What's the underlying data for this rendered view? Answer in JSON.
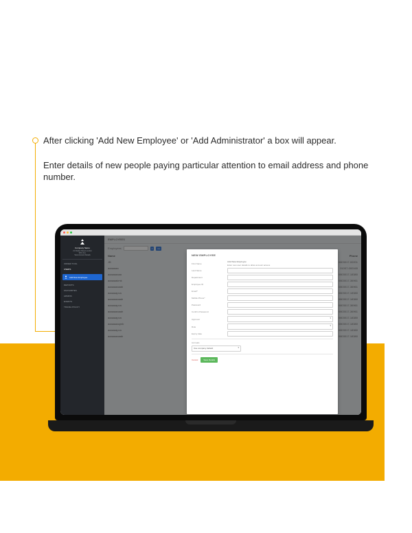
{
  "callout": {
    "p1": "After clicking 'Add New Employee' or 'Add Administrator' a box will appear.",
    "p2": "Enter details of new people paying particular attention to email address and phone number."
  },
  "sidebar": {
    "company_name": "Company Name",
    "address_line1": "21 Packet Street London",
    "address_line2": "WC1 4LL",
    "address_line3": "View Account Details",
    "nav": {
      "order": "ORDER TOOL",
      "users": "USERS",
      "reports": "REPORTS",
      "favourites": "FAVOURITES",
      "admins": "ADMINS",
      "events": "EVENTS",
      "policy": "TRAVEL POLICY"
    },
    "add_button": "Add New Employee"
  },
  "page_header": "EMPLOYEES",
  "toolbar": {
    "filter_label": "Employees",
    "search_placeholder": "",
    "btn1": "▾",
    "btn2": "Go"
  },
  "columns": {
    "name": "Name",
    "email": "",
    "phone": "Phone"
  },
  "rows": [
    {
      "name": "JB",
      "phone": "0803017-00201"
    },
    {
      "name": "aaaaaaa",
      "phone": "01007-000165"
    },
    {
      "name": "aaaaaaaaa",
      "phone": "0803017-18380"
    },
    {
      "name": "aaaaaakmk",
      "phone": "0803017-36961"
    },
    {
      "name": "aaaaaaaaab",
      "phone": "0803017-36961"
    },
    {
      "name": "aaaaaapva",
      "phone": "0803017-18380"
    },
    {
      "name": "aaaaaaaaab",
      "phone": "0803017-18380"
    },
    {
      "name": "aaaaaapva",
      "phone": "0803017-36961"
    },
    {
      "name": "aaaaaaaaab",
      "phone": "0803017-36961"
    },
    {
      "name": "aaaaaapva",
      "phone": "0803017-18380"
    },
    {
      "name": "aaaaaaaqmb",
      "phone": "0803017-18380"
    },
    {
      "name": "aaaaaapva",
      "phone": "0803017-18380"
    },
    {
      "name": "aaaaaaaaab",
      "phone": "0803017-18380"
    }
  ],
  "modal": {
    "title": "NEW EMPLOYEE",
    "hint_title": "Add New Employee",
    "hint_sub": "Enter new user details to allow account access",
    "fields": {
      "first_name": "First Name",
      "last_name": "Last Name",
      "department": "Department",
      "employee_id": "Employee ID",
      "email": "Email*",
      "mobile": "Mobile Phone*",
      "password": "Password",
      "confirm": "Confirm Password",
      "approver": "Approver",
      "role": "Role",
      "expiry": "Expiry date"
    },
    "accrual_label": "Accruals",
    "accrual_value": "Use company default",
    "cancel": "Cancel",
    "save": "Save Details"
  }
}
